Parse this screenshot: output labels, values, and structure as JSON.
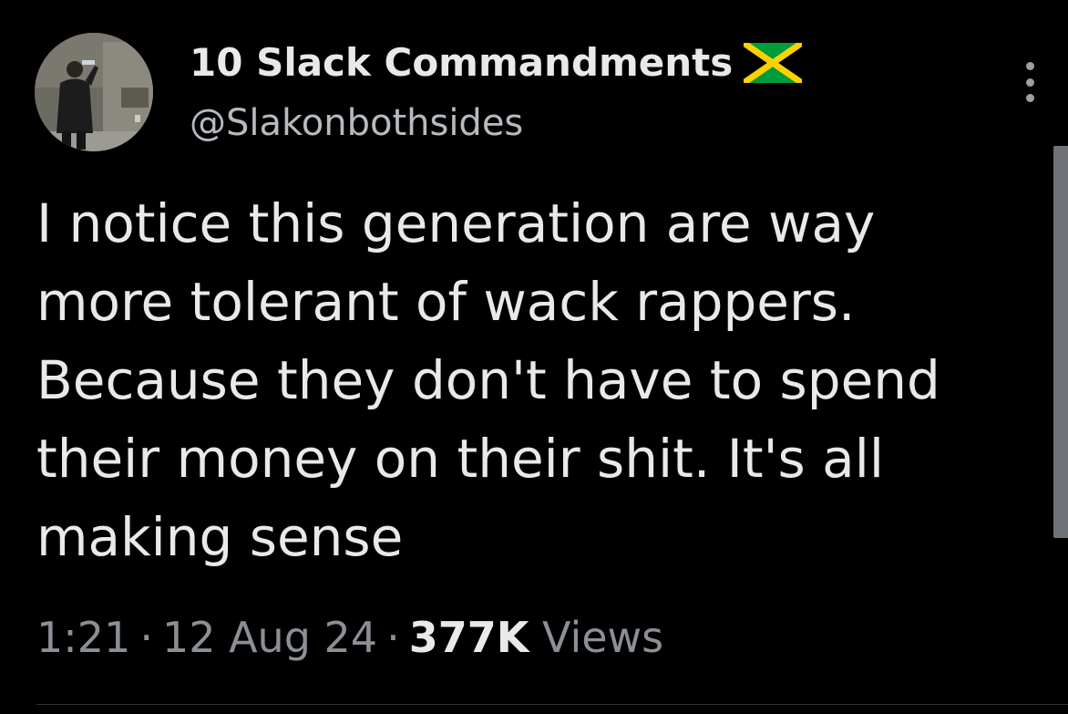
{
  "author": {
    "display_name": "10 Slack Commandments",
    "flag_icon": "jamaica-flag-icon",
    "handle": "@Slakonbothsides"
  },
  "tweet": {
    "lines": [
      "I notice this generation are way",
      "more tolerant of wack rappers.",
      "Because they don't have to spend",
      "their money on their shit. It's all",
      "making sense"
    ]
  },
  "meta": {
    "time": "1:21",
    "separator": "·",
    "date": "12 Aug 24",
    "views_count": "377K",
    "views_label": "Views"
  },
  "colors": {
    "background": "#000000",
    "text_primary": "#e7e9ea",
    "text_secondary": "#8b9096",
    "flag_green": "#009b3a",
    "flag_yellow": "#fed100",
    "flag_black": "#000000"
  }
}
